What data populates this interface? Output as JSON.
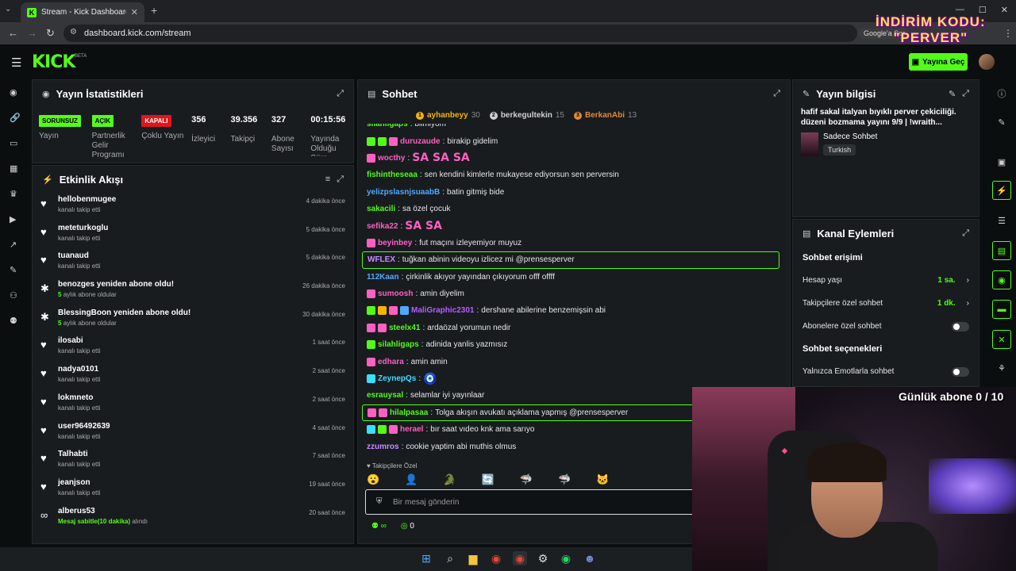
{
  "browser": {
    "tab_title": "Stream - Kick Dashboard",
    "url": "dashboard.kick.com/stream",
    "google_pill": "Google'a Sor"
  },
  "overlay": {
    "promo_line1": "İNDİRİM KODU:",
    "promo_line2": "\"PERVER\"",
    "sub_goal": "Günlük abone 0 / 10"
  },
  "header": {
    "logo": "KICK",
    "beta": "BETA",
    "go_live": "Yayına Geç"
  },
  "stats_panel": {
    "title": "Yayın İstatistikleri",
    "items": [
      {
        "badge": "SORUNSUZ",
        "label": "Yayın",
        "color": "green"
      },
      {
        "badge": "AÇIK",
        "label": "Partnerlik Gelir Programı",
        "color": "green"
      },
      {
        "badge": "KAPALI",
        "label": "Çoklu Yayın",
        "color": "red"
      },
      {
        "value": "356",
        "label": "İzleyici"
      },
      {
        "value": "39.356",
        "label": "Takipçi"
      },
      {
        "value": "327",
        "label": "Abone Sayısı"
      },
      {
        "value": "00:15:56",
        "label": "Yayında Olduğu Süre"
      }
    ]
  },
  "activity": {
    "title": "Etkinlik Akışı",
    "items": [
      {
        "name": "hellobenmugee",
        "sub": "kanalı takip etti",
        "time": "4 dakika önce",
        "type": "follow"
      },
      {
        "name": "meteturkoglu",
        "sub": "kanalı takip etti",
        "time": "5 dakika önce",
        "type": "follow"
      },
      {
        "name": "tuanaud",
        "sub": "kanalı takip etti",
        "time": "5 dakika önce",
        "type": "follow"
      },
      {
        "name": "benozges yeniden abone oldu!",
        "sub_num": "5",
        "sub": "aylık abone oldular",
        "time": "26 dakika önce",
        "type": "sub"
      },
      {
        "name": "BlessingBoon yeniden abone oldu!",
        "sub_num": "5",
        "sub": "aylık abone oldular",
        "time": "30 dakika önce",
        "type": "sub"
      },
      {
        "name": "ilosabi",
        "sub": "kanalı takip etti",
        "time": "1 saat önce",
        "type": "follow"
      },
      {
        "name": "nadya0101",
        "sub": "kanalı takip etti",
        "time": "2 saat önce",
        "type": "follow"
      },
      {
        "name": "lokmneto",
        "sub": "kanalı takip etti",
        "time": "2 saat önce",
        "type": "follow"
      },
      {
        "name": "user96492639",
        "sub": "kanalı takip etti",
        "time": "4 saat önce",
        "type": "follow"
      },
      {
        "name": "Talhabti",
        "sub": "kanalı takip etti",
        "time": "7 saat önce",
        "type": "follow"
      },
      {
        "name": "jeanjson",
        "sub": "kanalı takip etti",
        "time": "19 saat önce",
        "type": "follow"
      },
      {
        "name": "alberus53",
        "sub_num": "Mesaj sabitle(10 dakika)",
        "sub": "alındı",
        "time": "20 saat önce",
        "type": "pin"
      }
    ]
  },
  "chat": {
    "title": "Sohbet",
    "top": [
      {
        "name": "ayhanbeyy",
        "count": "30",
        "color": "#f5b400",
        "rank": "1"
      },
      {
        "name": "berkegultekin",
        "count": "15",
        "color": "#d0d0d0",
        "rank": "2"
      },
      {
        "name": "BerkanAbi",
        "count": "13",
        "color": "#e0893a",
        "rank": "3"
      }
    ],
    "messages": [
      {
        "user": "silahligaps",
        "text": "bilmiyom",
        "color": "#53fc18"
      },
      {
        "user": "duruzaude",
        "text": "birakip gidelim",
        "color": "#ff5fc3",
        "badges": [
          "#53fc18",
          "#53fc18",
          "#ff5fc3"
        ]
      },
      {
        "user": "wocthy",
        "text": "",
        "emote": "SA SA SA",
        "color": "#ff5fc3",
        "badges": [
          "#ff5fc3"
        ]
      },
      {
        "user": "fishintheseaa",
        "text": "sen kendini kimlerle mukayese ediyorsun sen perversin",
        "color": "#53fc18"
      },
      {
        "user": "yelizpslasnjsuaabB",
        "text": "batin gitmiş bide",
        "color": "#4fa8ff"
      },
      {
        "user": "sakacili",
        "text": "sa özel çocuk",
        "color": "#53fc18"
      },
      {
        "user": "sefika22",
        "text": "",
        "emote": "SA SA",
        "color": "#ff5fc3"
      },
      {
        "user": "beyinbey",
        "text": "fut maçını izleyemiyor muyuz",
        "color": "#ff5fc3",
        "badges": [
          "#ff5fc3"
        ]
      },
      {
        "user": "WFLEX",
        "text": "tuğkan abinin videoyu izlicez mi @prensesperver",
        "color": "#c68cff",
        "highlight": true
      },
      {
        "user": "112Kaan",
        "text": "çirkinlik akıyor yayından çıkıyorum offf offff",
        "color": "#4fa8ff"
      },
      {
        "user": "sumoosh",
        "text": "amin diyelim",
        "color": "#ff5fc3",
        "badges": [
          "#ff5fc3"
        ]
      },
      {
        "user": "MaliGraphic2301",
        "text": "dershane abilerine benzemişsin abi",
        "color": "#b55cff",
        "badges": [
          "#53fc18",
          "#f5b400",
          "#ff5fc3",
          "#4fa8ff"
        ]
      },
      {
        "user": "steelx41",
        "text": "ardaözal yorumun nedir",
        "color": "#53fc18",
        "badges": [
          "#ff5fc3",
          "#ff5fc3"
        ]
      },
      {
        "user": "silahligaps",
        "text": "adinida yanlis yazmısız",
        "color": "#53fc18",
        "badges": [
          "#53fc18"
        ]
      },
      {
        "user": "edhara",
        "text": "amin amin",
        "color": "#ff5fc3",
        "badges": [
          "#ff5fc3"
        ]
      },
      {
        "user": "ZeynepQs",
        "text": "",
        "emote": "🧿",
        "color": "#37e0ff",
        "badges": [
          "#37e0ff"
        ]
      },
      {
        "user": "esrauysal",
        "text": "selamlar iyi yayınlaar",
        "color": "#53fc18"
      },
      {
        "user": "hilalpasaa",
        "text": "Tolga akışın avukatı açıklama yapmış @prensesperver",
        "color": "#53fc18",
        "badges": [
          "#ff5fc3",
          "#ff5fc3"
        ],
        "highlight": true
      },
      {
        "user": "herael",
        "text": "bır saat vıdeo knk ama sarıyo",
        "color": "#ff5fc3",
        "badges": [
          "#37e0ff",
          "#53fc18",
          "#ff5fc3"
        ]
      },
      {
        "user": "zzumros",
        "text": "cookie yaptim abi muthis olmus",
        "color": "#c68cff"
      }
    ],
    "followers_only": "Takipçilere Özel",
    "input_placeholder": "Bir mesaj gönderin",
    "points": "0"
  },
  "stream_info": {
    "title": "Yayın bilgisi",
    "stream_title": "hafif sakal italyan bıyıklı perver çekiciliği. düzeni bozmama yayını 9/9 | !wraith...",
    "category": "Sadece Sohbet",
    "language": "Turkish"
  },
  "channel_actions": {
    "title": "Kanal Eylemleri",
    "section1": "Sohbet erişimi",
    "account_age_label": "Hesap yaşı",
    "account_age_value": "1 sa.",
    "followers_chat_label": "Takipçilere özel sohbet",
    "followers_chat_value": "1 dk.",
    "subs_chat_label": "Abonelere özel sohbet",
    "section2": "Sohbet seçenekleri",
    "emote_only_label": "Yalnızca Emotlarla sohbet"
  },
  "colors": {
    "accent": "#53fc18",
    "panel": "#181c1f",
    "bg": "#0b0e0f",
    "offline": "#e0151b"
  }
}
